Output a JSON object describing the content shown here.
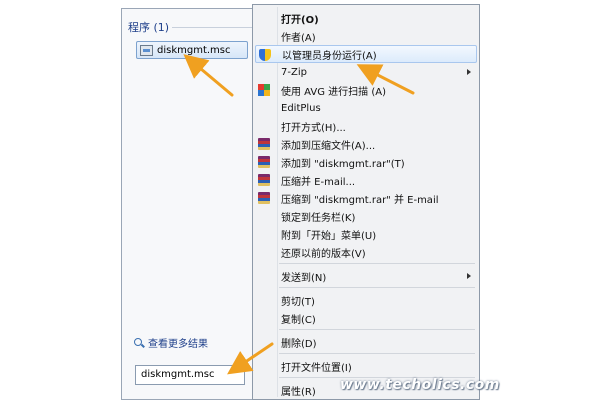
{
  "start_menu": {
    "section_header": "程序 (1)",
    "program": {
      "label": "diskmgmt.msc",
      "icon": "msc-app-icon"
    },
    "see_more": "查看更多结果",
    "search_value": "diskmgmt.msc"
  },
  "context_menu": {
    "items": [
      {
        "label": "打开(O)",
        "bold": true
      },
      {
        "label": "作者(A)"
      },
      {
        "label": "以管理员身份运行(A)",
        "icon": "uac-shield-icon",
        "highlight": true
      },
      {
        "label": "7-Zip",
        "submenu": true
      },
      {
        "label": "使用 AVG 进行扫描 (A)",
        "icon": "avg-icon"
      },
      {
        "label": "EditPlus"
      },
      {
        "label": "打开方式(H)..."
      },
      {
        "label": "添加到压缩文件(A)...",
        "icon": "winrar-icon"
      },
      {
        "label": "添加到 \"diskmgmt.rar\"(T)",
        "icon": "winrar-icon"
      },
      {
        "label": "压缩并 E-mail...",
        "icon": "winrar-icon"
      },
      {
        "label": "压缩到 \"diskmgmt.rar\" 并 E-mail",
        "icon": "winrar-icon"
      },
      {
        "label": "锁定到任务栏(K)"
      },
      {
        "label": "附到「开始」菜单(U)"
      },
      {
        "label": "还原以前的版本(V)"
      },
      {
        "label": "发送到(N)",
        "submenu": true
      },
      {
        "label": "剪切(T)"
      },
      {
        "label": "复制(C)"
      },
      {
        "label": "删除(D)"
      },
      {
        "label": "打开文件位置(I)"
      },
      {
        "label": "属性(R)"
      }
    ]
  },
  "watermark": "www.techolics.com",
  "colors": {
    "highlight": "#dcebfc",
    "annotation_arrow": "#f0a020",
    "link": "#1e3f8a"
  }
}
